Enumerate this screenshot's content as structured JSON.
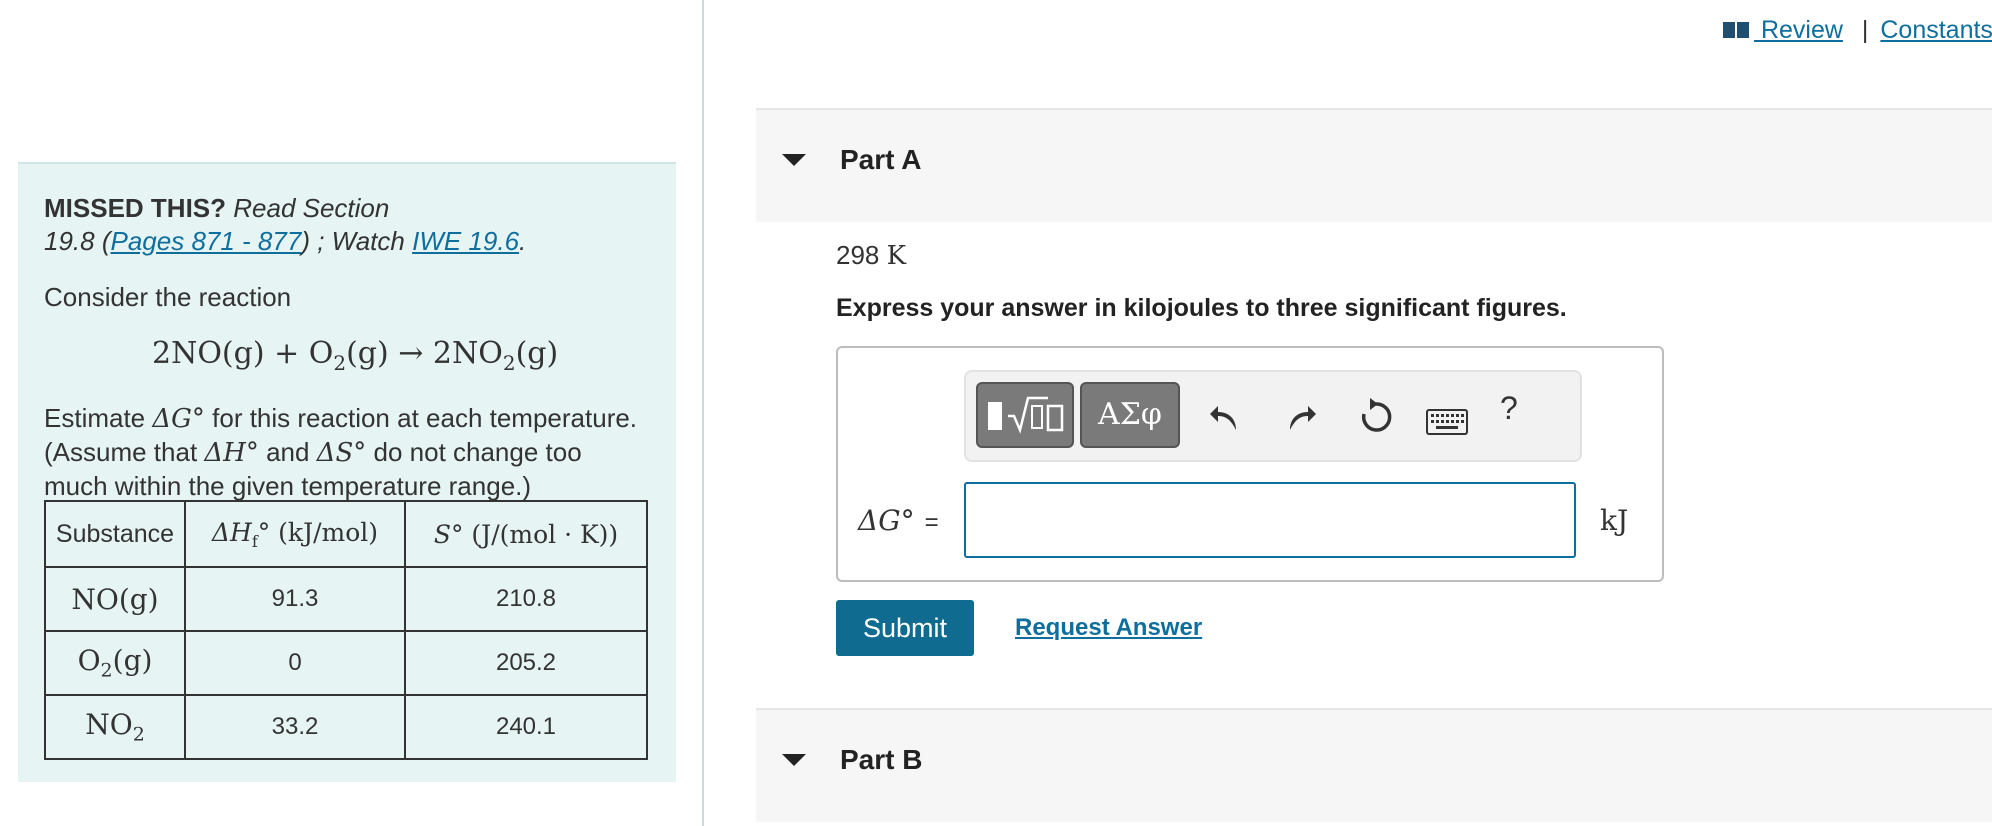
{
  "top_links": {
    "review": " Review",
    "separator": "|",
    "constants": "Constants"
  },
  "left": {
    "missed_bold": "MISSED THIS?",
    "missed_read": "Read Section",
    "missed_section": "19.8 (",
    "pages_link": "Pages 871 - 877",
    "watch_text": ") ; Watch ",
    "iwe_link": "IWE 19.6",
    "period": ".",
    "consider": "Consider the reaction",
    "estimate_line1a": "Estimate ",
    "delta_g": "ΔG°",
    "estimate_line1b": " for this reaction at each temperature.",
    "estimate_line2a": "(Assume that ",
    "delta_h": "ΔH°",
    "estimate_and": " and ",
    "delta_s": "ΔS°",
    "estimate_line2b": " do not change too",
    "estimate_line3": "much within the given temperature range.)",
    "table": {
      "headers": [
        "Substance",
        "ΔHf° (kJ/mol)",
        "S° (J/(mol·K))"
      ],
      "rows": [
        {
          "substance": "NO(g)",
          "dh": "91.3",
          "s": "210.8"
        },
        {
          "substance": "O2(g)",
          "dh": "0",
          "s": "205.2"
        },
        {
          "substance": "NO2",
          "dh": "33.2",
          "s": "240.1"
        }
      ]
    }
  },
  "part_a": {
    "title": "Part A",
    "temperature": "298",
    "temperature_unit": "K",
    "instruction": "Express your answer in kilojoules to three significant figures.",
    "toolbar": {
      "greek_label": "ΑΣφ",
      "help_label": "?"
    },
    "answer_label": "ΔG°",
    "equals": "=",
    "answer_value": "",
    "unit": "kJ",
    "submit_label": "Submit",
    "request_label": "Request Answer"
  },
  "part_b": {
    "title": "Part B"
  },
  "colors": {
    "accent": "#0f6b8f",
    "panel_bg": "#e7f4f4",
    "link": "#0e6e9e"
  }
}
